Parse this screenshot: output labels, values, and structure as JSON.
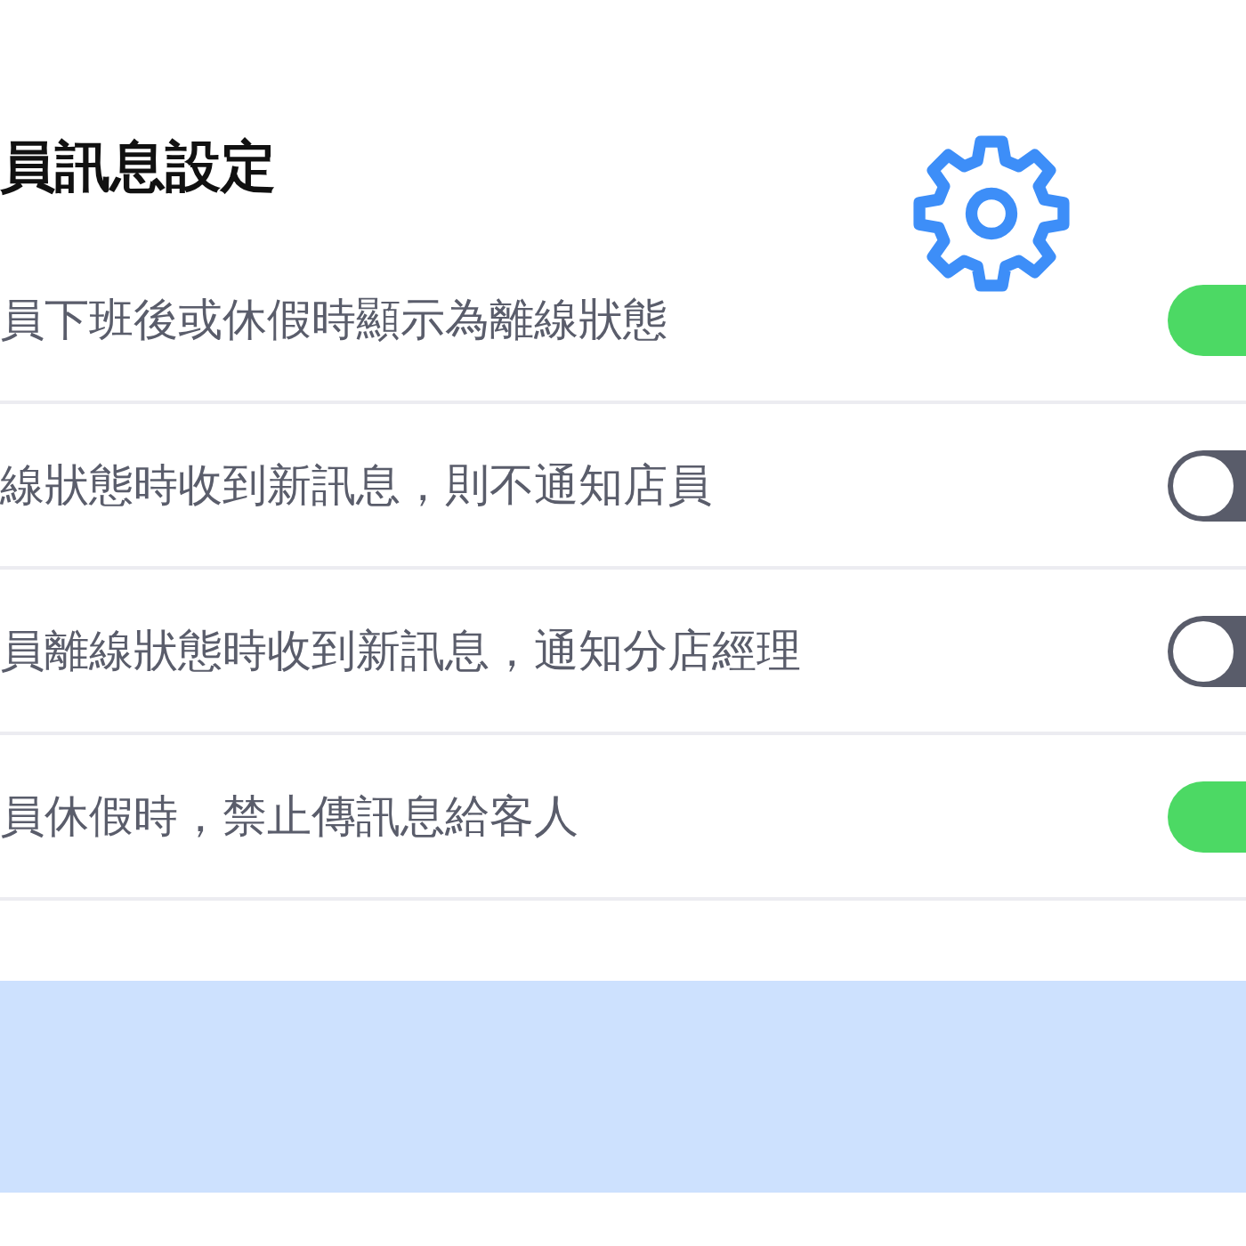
{
  "header": {
    "title": "員訊息設定"
  },
  "settings": [
    {
      "label": "員下班後或休假時顯示為離線狀態",
      "on": true
    },
    {
      "label": "線狀態時收到新訊息，則不通知店員",
      "on": false
    },
    {
      "label": "員離線狀態時收到新訊息，通知分店經理",
      "on": false
    },
    {
      "label": "員休假時，禁止傳訊息給客人",
      "on": true
    }
  ]
}
